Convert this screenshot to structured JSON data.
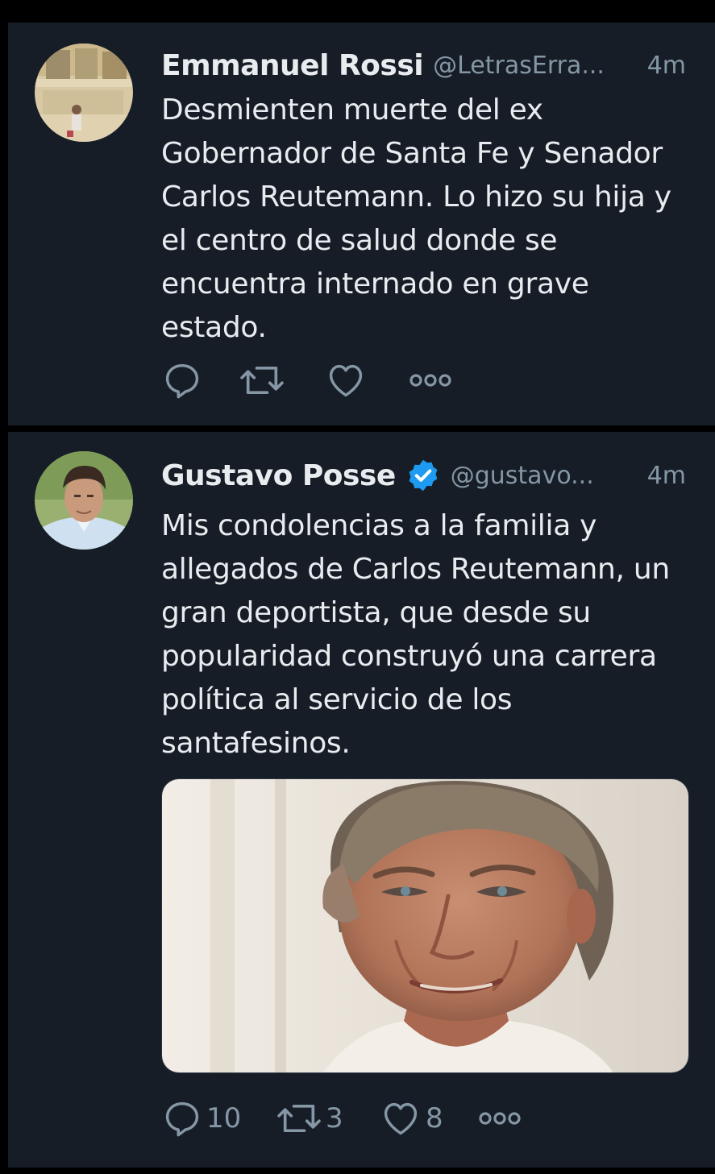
{
  "tweets": [
    {
      "display_name": "Emmanuel Rossi",
      "handle": "@LetrasErra...",
      "time": "4m",
      "verified": false,
      "text": "Desmienten muerte del ex Gobernador de Santa Fe y Senador Carlos Reutemann. Lo hizo su hija y el centro de salud donde se encuentra internado en grave estado.",
      "actions": {
        "reply_icon": "reply-icon",
        "retweet_icon": "retweet-icon",
        "like_icon": "heart-icon",
        "more_icon": "more-icon",
        "reply_count": "",
        "retweet_count": "",
        "like_count": ""
      }
    },
    {
      "display_name": "Gustavo Posse",
      "handle": "@gustavo...",
      "time": "4m",
      "verified": true,
      "text": "Mis condolencias a la familia y allegados de Carlos Reutemann, un gran deportista, que desde su popularidad construyó una carrera política al servicio de los santafesinos.",
      "actions": {
        "reply_icon": "reply-icon",
        "retweet_icon": "retweet-icon",
        "like_icon": "heart-icon",
        "more_icon": "more-icon",
        "reply_count": "10",
        "retweet_count": "3",
        "like_count": "8"
      }
    }
  ],
  "colors": {
    "background": "#161d27",
    "text": "#e8ecef",
    "secondary_text": "#8596a5",
    "verified": "#1d9bf0"
  }
}
